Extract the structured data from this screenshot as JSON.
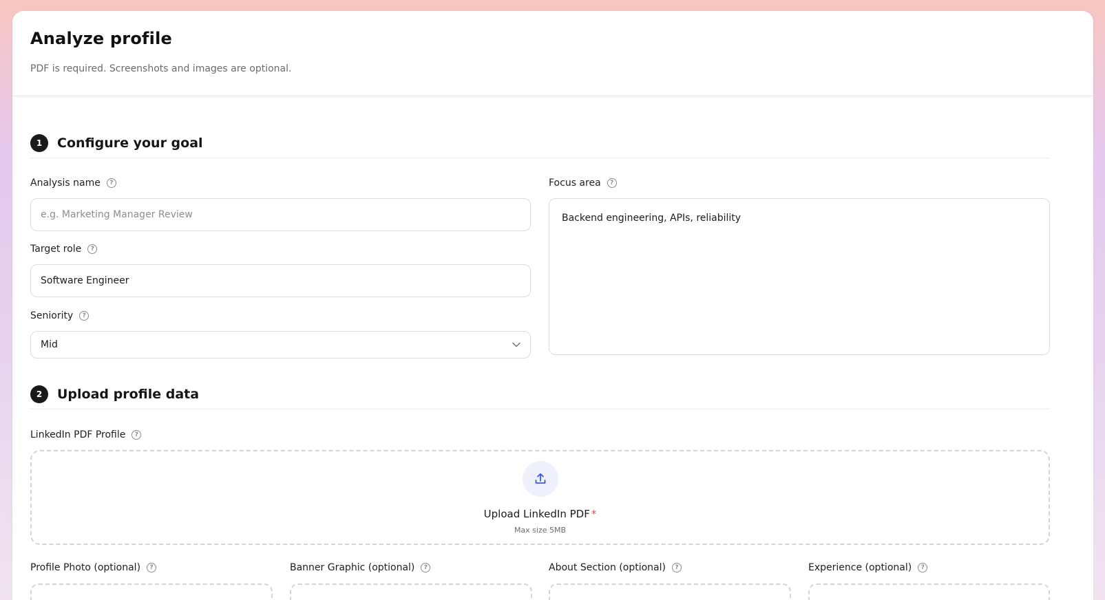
{
  "header": {
    "title": "Analyze profile",
    "subtitle": "PDF is required. Screenshots and images are optional."
  },
  "section1": {
    "number": "1",
    "title": "Configure your goal",
    "analysis_name": {
      "label": "Analysis name",
      "placeholder": "e.g. Marketing Manager Review",
      "value": ""
    },
    "target_role": {
      "label": "Target role",
      "value": "Software Engineer"
    },
    "seniority": {
      "label": "Seniority",
      "value": "Mid"
    },
    "focus_area": {
      "label": "Focus area",
      "value": "Backend engineering, APIs, reliability"
    }
  },
  "section2": {
    "number": "2",
    "title": "Upload profile data",
    "linkedin_pdf": {
      "label": "LinkedIn PDF Profile",
      "upload_title": "Upload LinkedIn PDF",
      "required_mark": "*",
      "max_size": "Max size 5MB"
    },
    "optional_uploads": [
      {
        "label": "Profile Photo (optional)"
      },
      {
        "label": "Banner Graphic (optional)"
      },
      {
        "label": "About Section (optional)"
      },
      {
        "label": "Experience (optional)"
      }
    ]
  },
  "icons": {
    "help": "question-circle-icon",
    "chevron": "chevron-down-icon",
    "upload": "upload-icon"
  },
  "colors": {
    "accent": "#3b5bdb",
    "required": "#e5484d",
    "step_badge": "#1a1a1a"
  }
}
